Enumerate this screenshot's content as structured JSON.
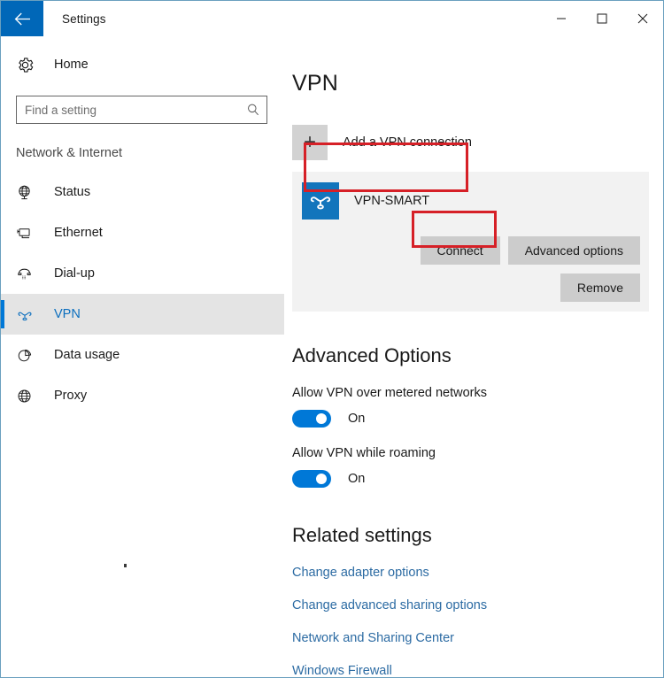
{
  "window": {
    "title": "Settings",
    "back_icon": "back-arrow-icon",
    "controls": {
      "minimize": "–",
      "maximize": "□",
      "close": "✕"
    }
  },
  "sidebar": {
    "home": {
      "label": "Home",
      "icon": "gear-icon"
    },
    "search": {
      "placeholder": "Find a setting",
      "value": "",
      "icon": "search-icon"
    },
    "category": "Network & Internet",
    "items": [
      {
        "label": "Status",
        "icon": "globe-status-icon",
        "selected": false
      },
      {
        "label": "Ethernet",
        "icon": "ethernet-icon",
        "selected": false
      },
      {
        "label": "Dial-up",
        "icon": "dialup-phone-icon",
        "selected": false
      },
      {
        "label": "VPN",
        "icon": "vpn-icon",
        "selected": true
      },
      {
        "label": "Data usage",
        "icon": "pie-chart-icon",
        "selected": false
      },
      {
        "label": "Proxy",
        "icon": "globe-proxy-icon",
        "selected": false
      }
    ]
  },
  "main": {
    "title": "VPN",
    "add_connection": {
      "label": "Add a VPN connection",
      "icon": "plus-icon"
    },
    "connection": {
      "name": "VPN-SMART",
      "icon": "vpn-knot-icon",
      "buttons": {
        "connect": "Connect",
        "advanced_options": "Advanced options",
        "remove": "Remove"
      }
    },
    "advanced": {
      "title": "Advanced Options",
      "options": [
        {
          "label": "Allow VPN over metered networks",
          "state": "On",
          "on": true
        },
        {
          "label": "Allow VPN while roaming",
          "state": "On",
          "on": true
        }
      ]
    },
    "related": {
      "title": "Related settings",
      "links": [
        "Change adapter options",
        "Change advanced sharing options",
        "Network and Sharing Center",
        "Windows Firewall"
      ]
    }
  },
  "annotations": {
    "highlight_color": "#d62027",
    "boxes": [
      {
        "target": "vpn-connection-entry"
      },
      {
        "target": "connect-button"
      }
    ]
  },
  "colors": {
    "accent_blue": "#0078d7",
    "titlebar_back": "#0067b8",
    "vpn_tile": "#1275bc",
    "link": "#2c6ba3",
    "card_bg": "#f2f2f2",
    "button_bg": "#cccccc"
  }
}
